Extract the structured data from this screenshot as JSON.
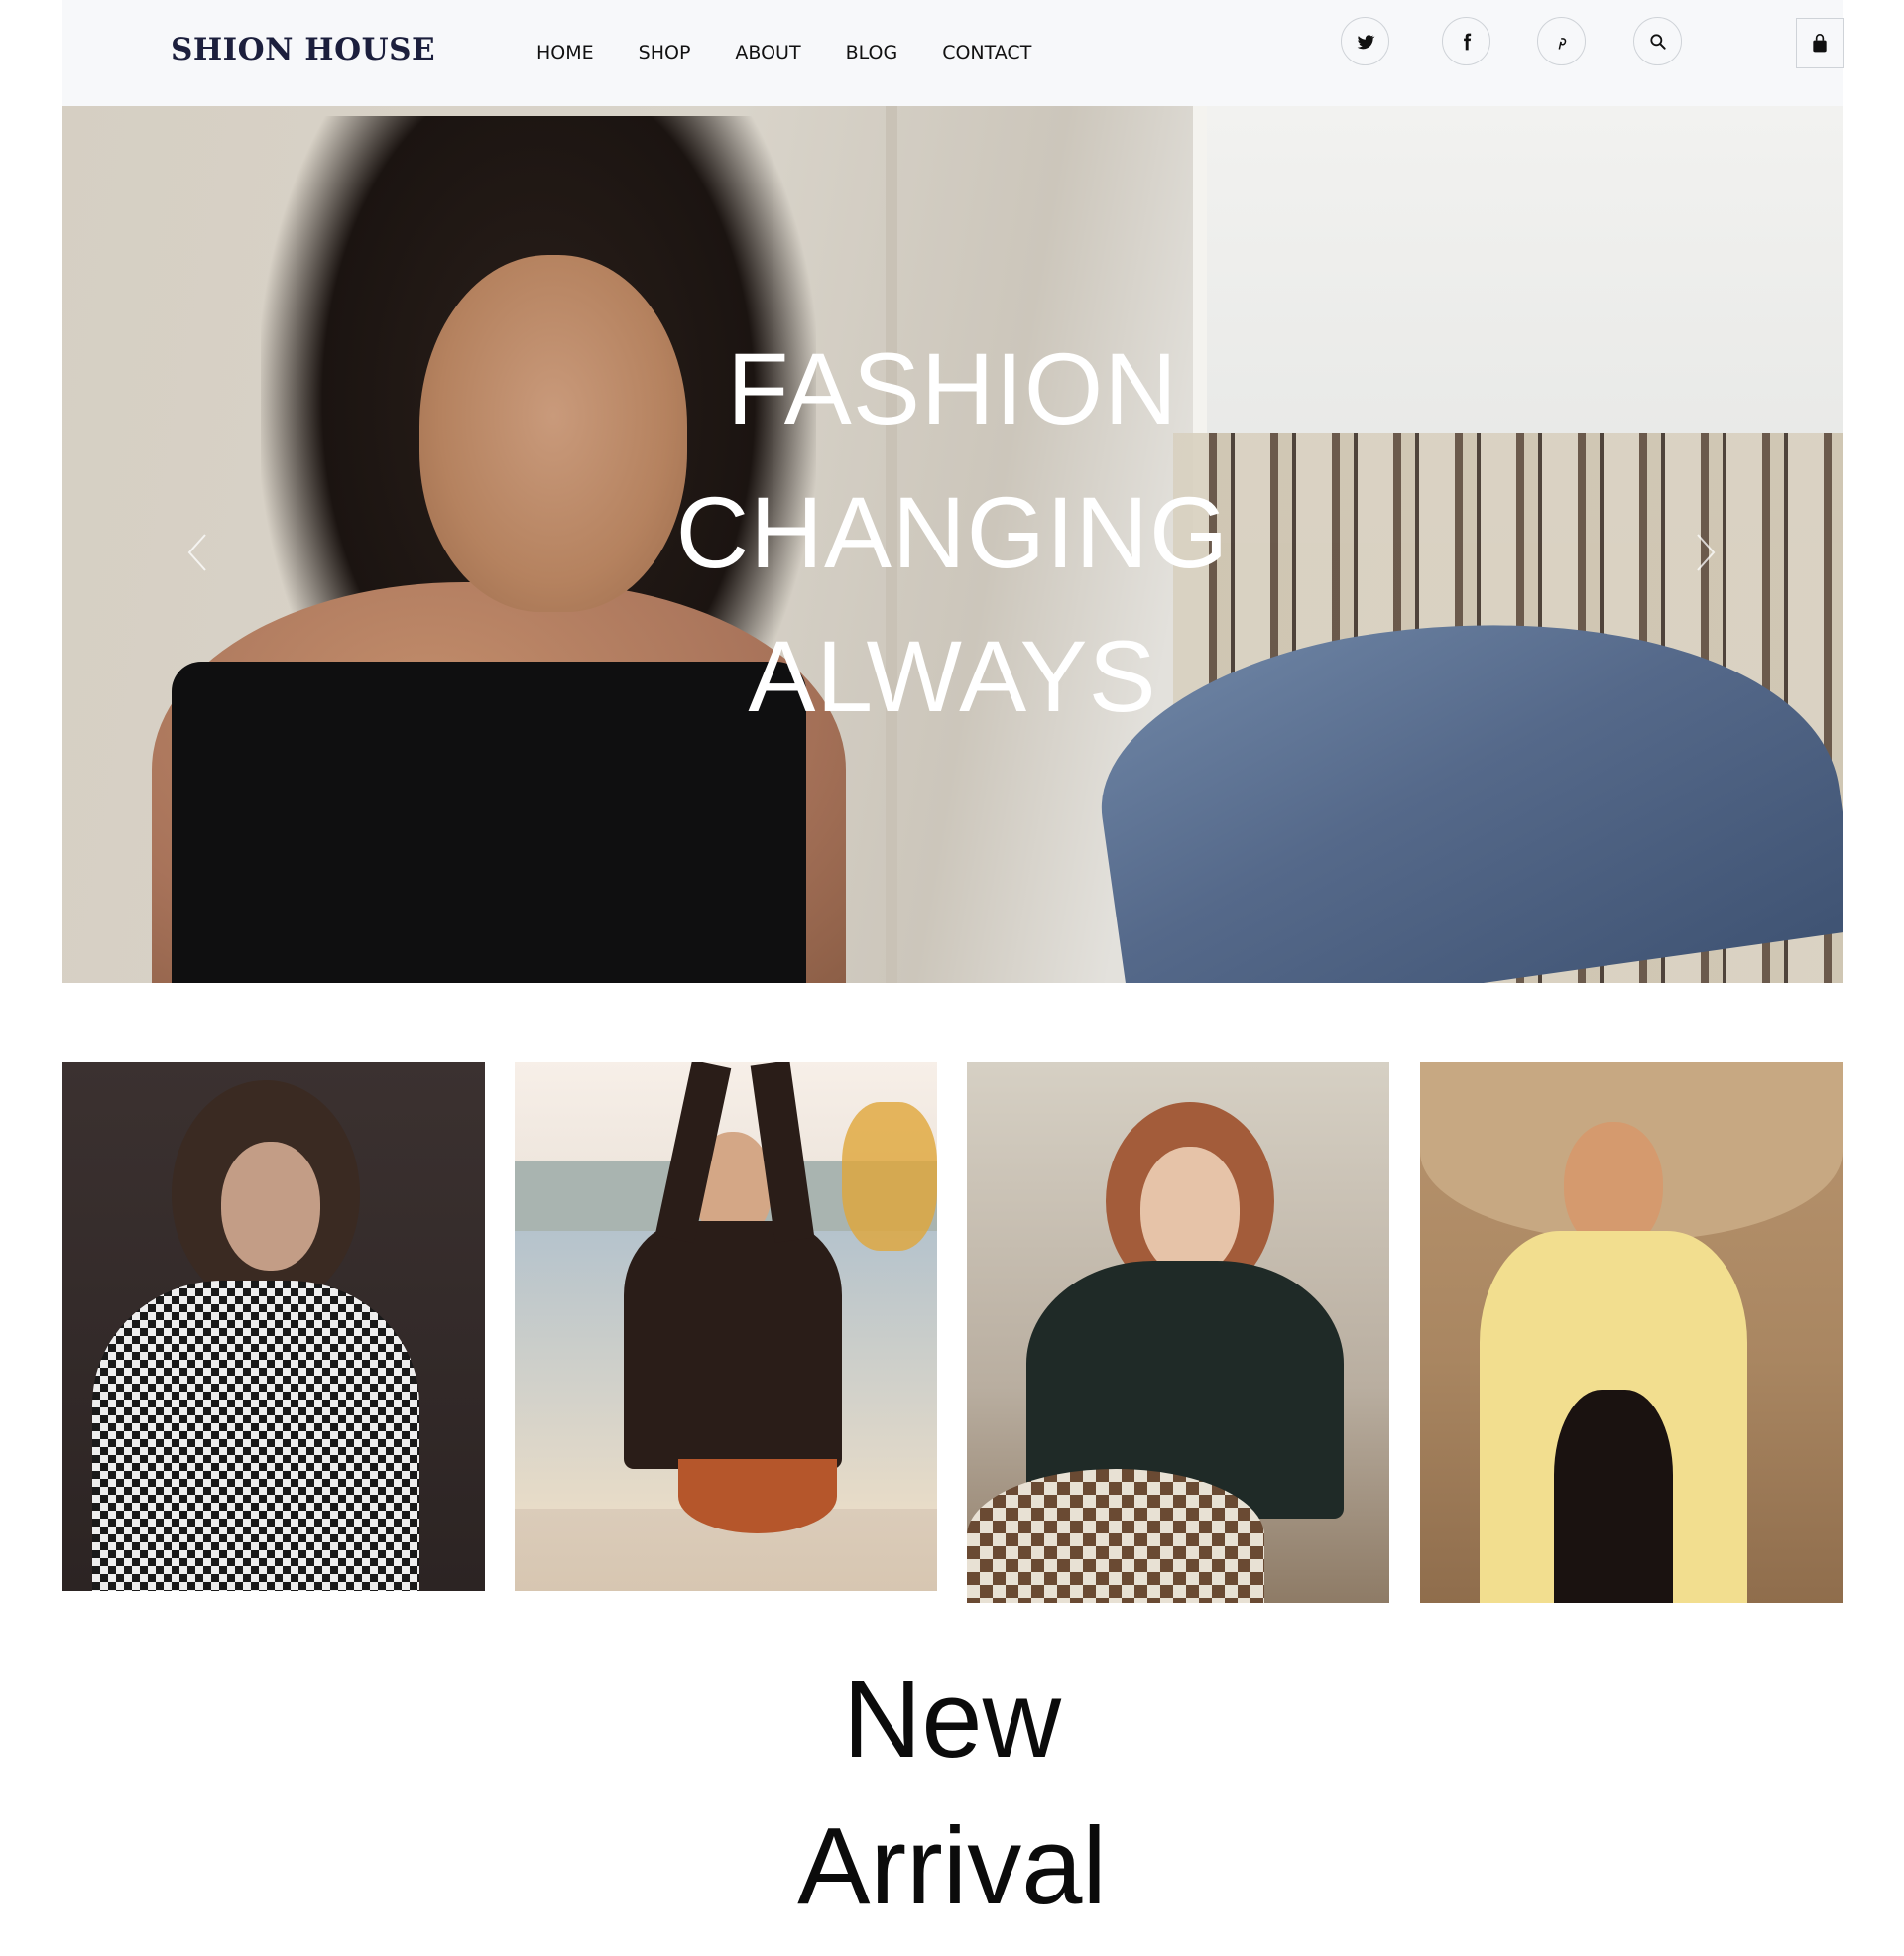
{
  "brand": {
    "logo": "SHION HOUSE"
  },
  "nav": {
    "items": [
      {
        "label": "HOME"
      },
      {
        "label": "SHOP"
      },
      {
        "label": "ABOUT"
      },
      {
        "label": "BLOG"
      },
      {
        "label": "CONTACT"
      }
    ]
  },
  "header_icons": [
    "twitter-icon",
    "facebook-icon",
    "pinterest-icon",
    "search-icon",
    "shopping-bag-icon"
  ],
  "hero": {
    "lines": [
      "FASHION",
      "CHANGING",
      "ALWAYS"
    ],
    "prev_icon": "chevron-left-icon",
    "next_icon": "chevron-right-icon"
  },
  "gallery": {
    "photos": [
      "photo-checkered-jacket",
      "photo-black-knit-sweater",
      "photo-chess-turtleneck",
      "photo-yellow-dress"
    ]
  },
  "section": {
    "lines": [
      "New",
      "Arrival"
    ]
  },
  "colors": {
    "logo": "#1c1f3d",
    "header_bg": "#f7f8fa",
    "hero_text": "#ffffff"
  }
}
